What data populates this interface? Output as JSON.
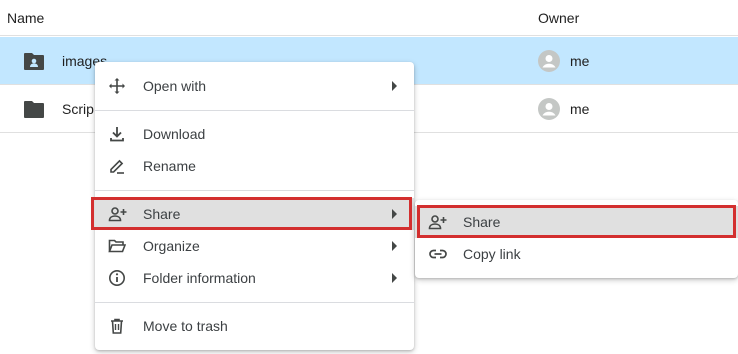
{
  "columns": {
    "name": "Name",
    "owner": "Owner"
  },
  "files": [
    {
      "name": "images",
      "owner": "me",
      "selected": true
    },
    {
      "name": "Scrip",
      "owner": "me",
      "selected": false
    }
  ],
  "context_menu": {
    "open_with": "Open with",
    "download": "Download",
    "rename": "Rename",
    "share": "Share",
    "organize": "Organize",
    "folder_information": "Folder information",
    "move_to_trash": "Move to trash"
  },
  "share_submenu": {
    "share": "Share",
    "copy_link": "Copy link"
  },
  "colors": {
    "selected_row": "#c2e7ff",
    "highlight": "#e0e0e0",
    "annotation_red": "#d32f2f",
    "icon_gray": "#5f6368"
  }
}
